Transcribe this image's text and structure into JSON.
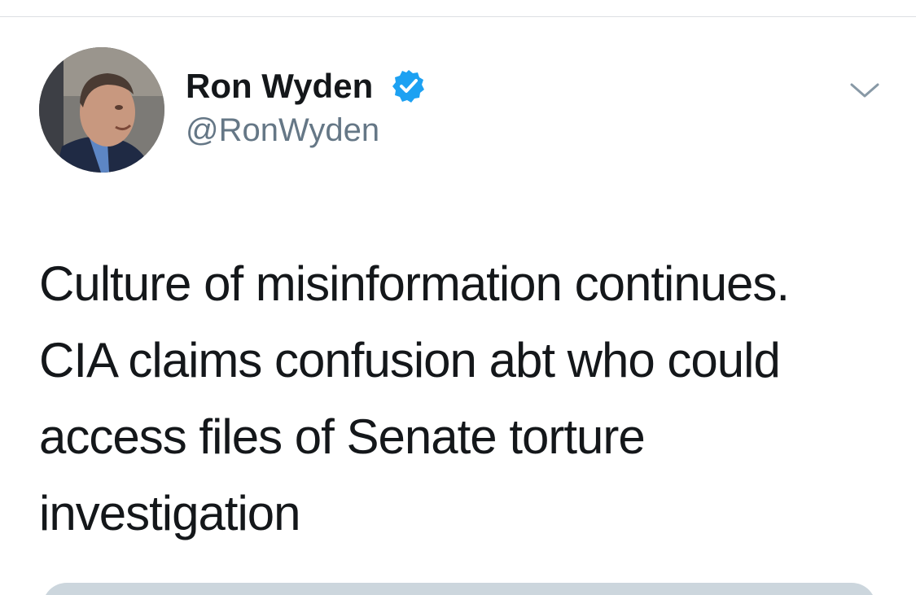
{
  "tweet": {
    "author": {
      "display_name": "Ron Wyden",
      "handle": "@RonWyden",
      "verified": true
    },
    "text_lines": [
      "Culture of misinformation continues.",
      "CIA claims confusion abt who could",
      "access files of Senate torture",
      "investigation"
    ]
  },
  "icons": {
    "verified": "verified-badge-icon",
    "menu": "chevron-down-icon"
  },
  "colors": {
    "text": "#14171a",
    "secondary_text": "#657786",
    "verified_blue": "#1da1f2",
    "card_gray": "#ccd6dd"
  }
}
